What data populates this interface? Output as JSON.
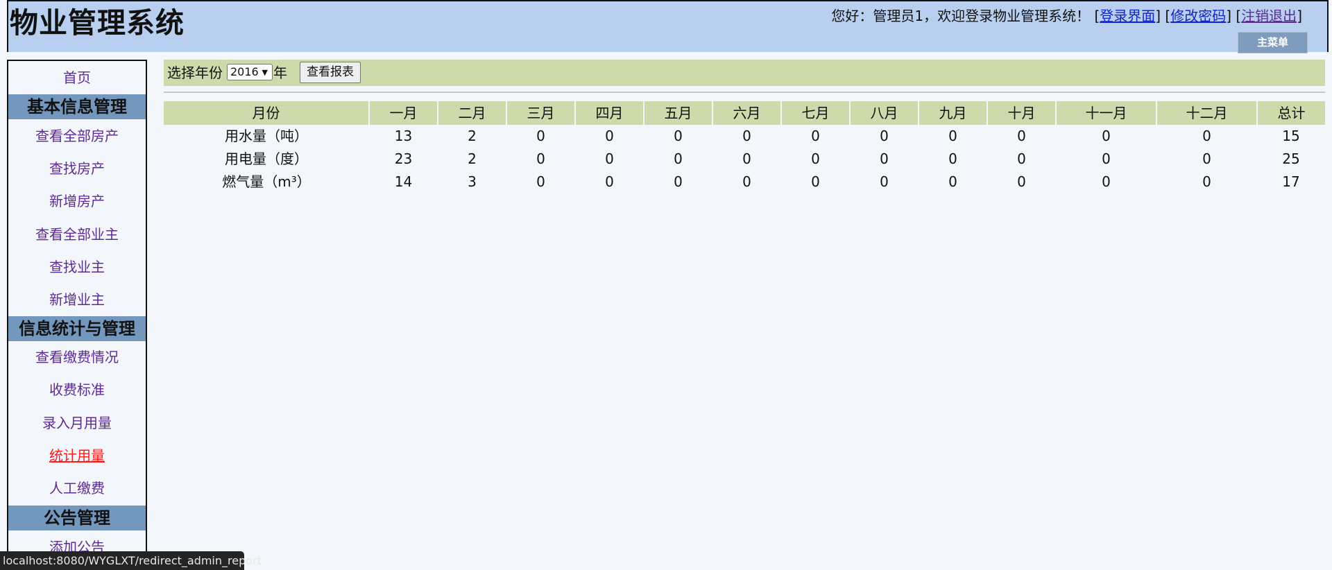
{
  "header": {
    "title": "物业管理系统",
    "greeting": "您好：管理员1，欢迎登录物业管理系统！",
    "links": {
      "login": "登录界面",
      "change_password": "修改密码",
      "logout": "注销退出"
    },
    "main_menu": "主菜单"
  },
  "sidebar": {
    "home": "首页",
    "sections": {
      "basic": {
        "title": "基本信息管理",
        "items": [
          "查看全部房产",
          "查找房产",
          "新增房产",
          "查看全部业主",
          "查找业主",
          "新增业主"
        ]
      },
      "stats": {
        "title": "信息统计与管理",
        "items": [
          "查看缴费情况",
          "收费标准",
          "录入月用量",
          "统计用量",
          "人工缴费"
        ]
      },
      "notice": {
        "title": "公告管理",
        "items": [
          "添加公告"
        ]
      }
    },
    "active_item": "统计用量"
  },
  "filter": {
    "label": "选择年份",
    "year": "2016",
    "year_unit": "年",
    "view_button": "查看报表"
  },
  "report": {
    "headers": [
      "月份",
      "一月",
      "二月",
      "三月",
      "四月",
      "五月",
      "六月",
      "七月",
      "八月",
      "九月",
      "十月",
      "十一月",
      "十二月",
      "总计"
    ],
    "rows": [
      {
        "label": "用水量（吨）",
        "values": [
          "13",
          "2",
          "0",
          "0",
          "0",
          "0",
          "0",
          "0",
          "0",
          "0",
          "0",
          "0",
          "15"
        ]
      },
      {
        "label": "用电量（度）",
        "values": [
          "23",
          "2",
          "0",
          "0",
          "0",
          "0",
          "0",
          "0",
          "0",
          "0",
          "0",
          "0",
          "25"
        ]
      },
      {
        "label": "燃气量（m³）",
        "values": [
          "14",
          "3",
          "0",
          "0",
          "0",
          "0",
          "0",
          "0",
          "0",
          "0",
          "0",
          "0",
          "17"
        ]
      }
    ]
  },
  "status_bar": {
    "url": "localhost:8080/WYGLXT/redirect_admin_report"
  },
  "colors": {
    "header_bg": "#b8cff0",
    "section_bg": "#7497bd",
    "table_header_bg": "#cddaac",
    "link_visited": "#5d2a94",
    "link_active": "#ff1a1a"
  }
}
